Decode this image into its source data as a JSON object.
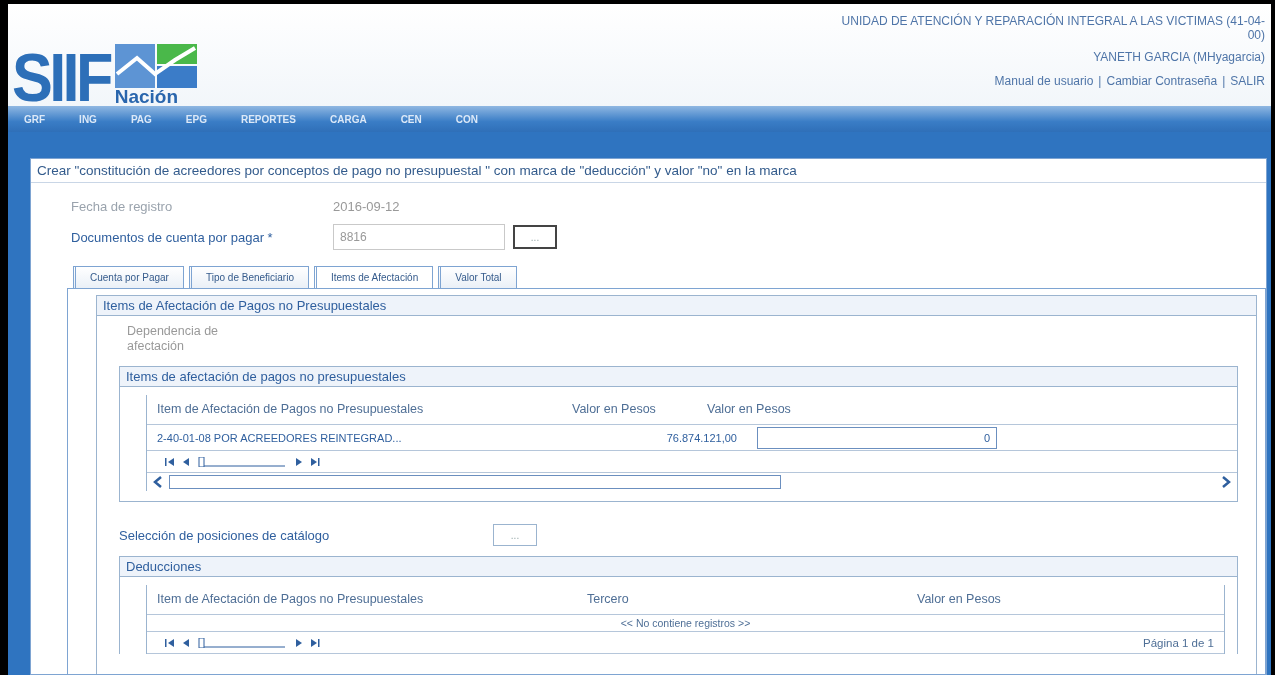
{
  "header": {
    "logo": {
      "text": "SIIF",
      "subtext": "Nación"
    },
    "entity": "UNIDAD DE ATENCIÓN Y REPARACIÓN INTEGRAL A LAS VICTIMAS (41-04-00)",
    "user": "YANETH GARCIA (MHyagarcia)",
    "links": [
      "Manual de usuario",
      "Cambiar Contraseña",
      "SALIR"
    ],
    "separator": "|"
  },
  "menu": [
    "GRF",
    "ING",
    "PAG",
    "EPG",
    "REPORTES",
    "CARGA",
    "CEN",
    "CON"
  ],
  "page_title": "Crear \"constitución de acreedores por conceptos de pago no presupuestal \" con marca de \"deducción\" y valor \"no\" en la marca",
  "fields": [
    {
      "kind": "static",
      "label": "Fecha de registro",
      "value": "2016-09-12"
    },
    {
      "kind": "lookup",
      "label": "Documentos de cuenta por pagar *",
      "value": "8816",
      "button": "..."
    }
  ],
  "tabs": [
    {
      "label": "Cuenta por Pagar",
      "selected": false
    },
    {
      "label": "Tipo de Beneficiario",
      "selected": false
    },
    {
      "label": "Items de Afectación",
      "selected": true
    },
    {
      "label": "Valor Total",
      "selected": false
    }
  ],
  "section": {
    "title": "Items de Afectación de Pagos no Presupuestales",
    "dependency_label": "Dependencia de afectación",
    "items_table": {
      "title": "Items de afectación de pagos no presupuestales",
      "columns": [
        "Item de Afectación de Pagos no Presupuestales",
        "Valor en Pesos",
        "Valor en Pesos"
      ],
      "rows": [
        {
          "item": "2-40-01-08 POR ACREEDORES REINTEGRAD...",
          "value": "76.874.121,00",
          "input": "0"
        }
      ]
    },
    "catalog": {
      "label": "Selección de posiciones de catálogo",
      "button": "..."
    },
    "deductions": {
      "title": "Deducciones",
      "columns": [
        "Item de Afectación de Pagos no Presupuestales",
        "Tercero",
        "Valor en Pesos"
      ],
      "empty": "<< No contiene registros >>",
      "page": "Página 1 de 1"
    }
  }
}
